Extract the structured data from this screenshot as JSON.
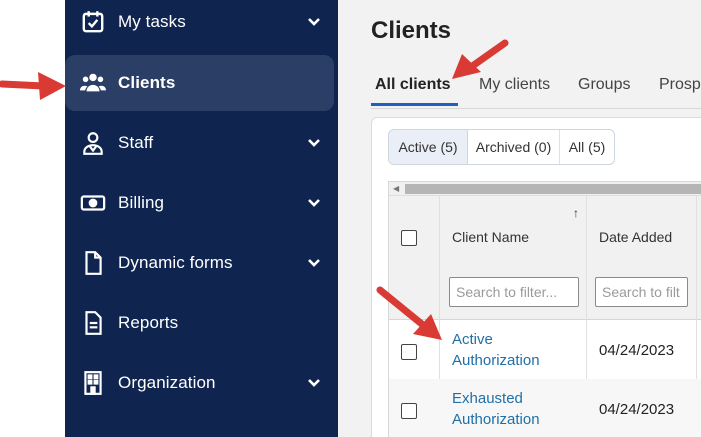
{
  "sidebar": {
    "items": [
      {
        "label": "My tasks",
        "icon": "calendar-check-icon",
        "has_chevron": true
      },
      {
        "label": "Clients",
        "icon": "users-icon",
        "has_chevron": false,
        "active": true
      },
      {
        "label": "Staff",
        "icon": "staff-person-icon",
        "has_chevron": true
      },
      {
        "label": "Billing",
        "icon": "money-bill-icon",
        "has_chevron": true
      },
      {
        "label": "Dynamic forms",
        "icon": "file-icon",
        "has_chevron": true
      },
      {
        "label": "Reports",
        "icon": "report-document-icon",
        "has_chevron": false
      },
      {
        "label": "Organization",
        "icon": "building-icon",
        "has_chevron": true
      }
    ]
  },
  "main": {
    "title": "Clients",
    "tabs": [
      {
        "label": "All clients",
        "active": true
      },
      {
        "label": "My clients"
      },
      {
        "label": "Groups"
      },
      {
        "label": "Prosp"
      }
    ],
    "filters": [
      {
        "label": "Active (5)",
        "active": true
      },
      {
        "label": "Archived (0)"
      },
      {
        "label": "All (5)"
      }
    ],
    "table": {
      "columns": [
        {
          "title": "Client Name",
          "filter_placeholder": "Search to filter...",
          "sort": "ascending"
        },
        {
          "title": "Date Added",
          "filter_placeholder": "Search to filt"
        }
      ],
      "rows": [
        {
          "name_line1": "Active",
          "name_line2": "Authorization",
          "date_added": "04/24/2023"
        },
        {
          "name_line1": "Exhausted",
          "name_line2": "Authorization",
          "date_added": "04/24/2023"
        }
      ]
    }
  },
  "colors": {
    "sidebar_bg": "#0f2550",
    "sidebar_active_bg": "#2b3f66",
    "accent_tab": "#1f5fbf",
    "link": "#1f6fa8",
    "annotation_arrow": "#d93a34"
  }
}
